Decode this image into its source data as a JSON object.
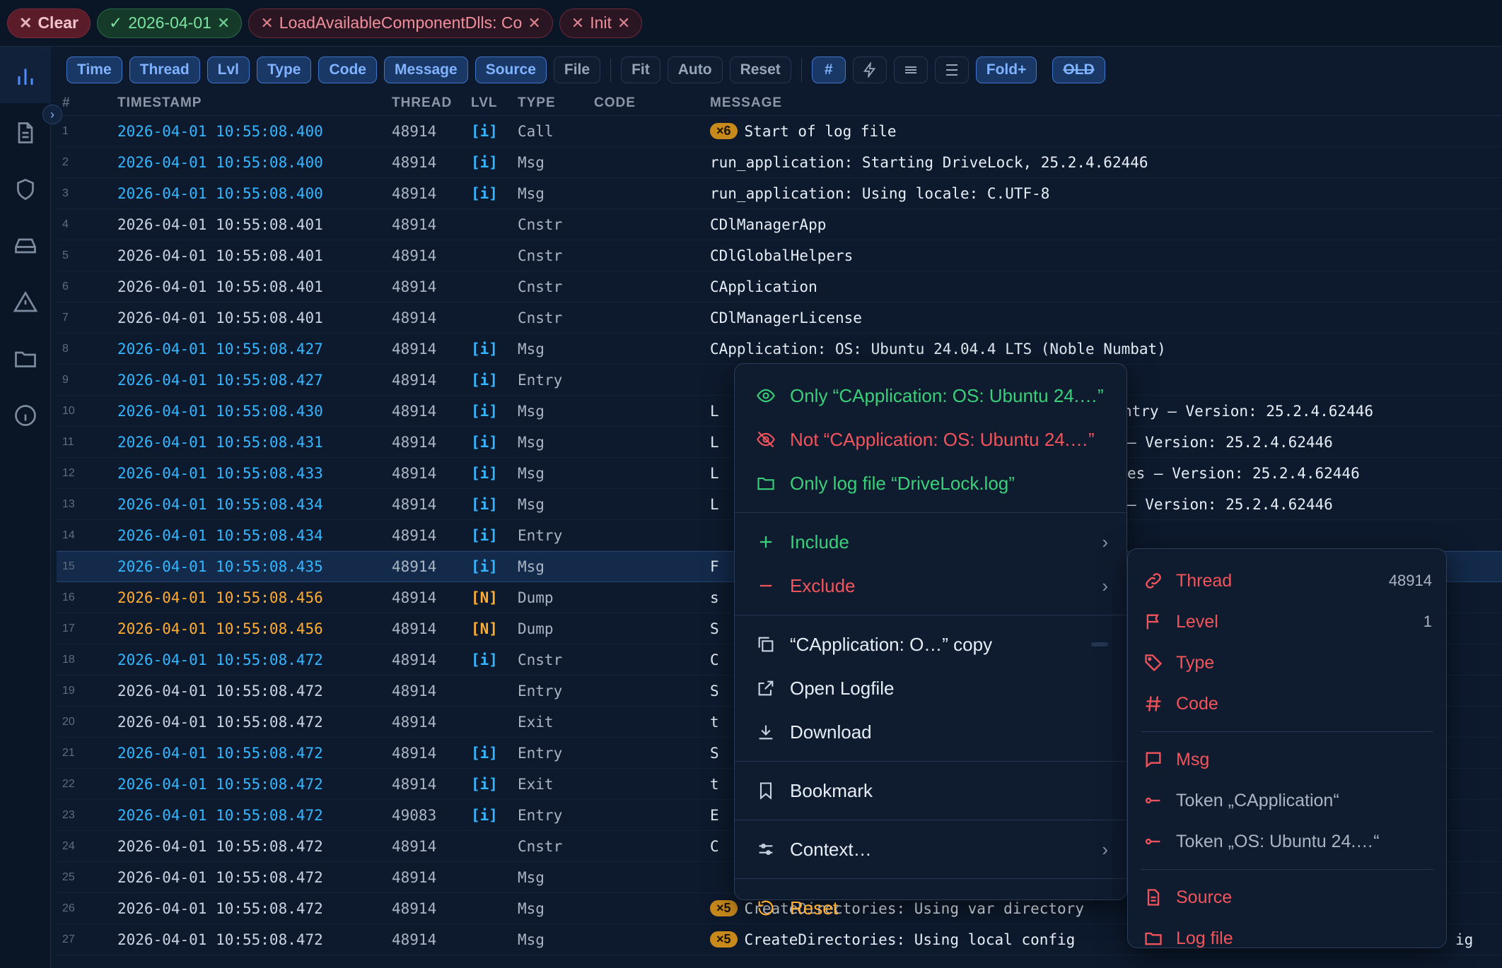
{
  "filters": {
    "clear": "Clear",
    "chips": [
      {
        "label": "2026-04-01",
        "kind": "include"
      },
      {
        "label": "LoadAvailableComponentDlls: Co",
        "kind": "exclude"
      },
      {
        "label": "Init",
        "kind": "exclude"
      }
    ]
  },
  "toolbar": {
    "columns": [
      "Time",
      "Thread",
      "Lvl",
      "Type",
      "Code",
      "Message",
      "Source",
      "File"
    ],
    "sizing": [
      "Fit",
      "Auto",
      "Reset"
    ],
    "hash": "#",
    "fold": "Fold+",
    "old": "OLD"
  },
  "table": {
    "headers": {
      "num": "#",
      "timestamp": "TIMESTAMP",
      "thread": "THREAD",
      "lvl": "LVL",
      "type": "TYPE",
      "code": "CODE",
      "message": "MESSAGE"
    },
    "rows": [
      {
        "n": "1",
        "ts": "2026-04-01 10:55:08.400",
        "th": "48914",
        "lvl": "[i]",
        "type": "Call",
        "badge": "×6",
        "msg": "Start of log file",
        "tone": "info"
      },
      {
        "n": "2",
        "ts": "2026-04-01 10:55:08.400",
        "th": "48914",
        "lvl": "[i]",
        "type": "Msg",
        "badge": "",
        "msg": "run_application: Starting DriveLock, 25.2.4.62446",
        "tone": "info"
      },
      {
        "n": "3",
        "ts": "2026-04-01 10:55:08.400",
        "th": "48914",
        "lvl": "[i]",
        "type": "Msg",
        "badge": "",
        "msg": "run_application: Using locale: C.UTF-8",
        "tone": "info"
      },
      {
        "n": "4",
        "ts": "2026-04-01 10:55:08.401",
        "th": "48914",
        "lvl": "",
        "type": "Cnstr",
        "badge": "",
        "msg": "CDlManagerApp",
        "tone": "plain"
      },
      {
        "n": "5",
        "ts": "2026-04-01 10:55:08.401",
        "th": "48914",
        "lvl": "",
        "type": "Cnstr",
        "badge": "",
        "msg": "CDlGlobalHelpers",
        "tone": "plain"
      },
      {
        "n": "6",
        "ts": "2026-04-01 10:55:08.401",
        "th": "48914",
        "lvl": "",
        "type": "Cnstr",
        "badge": "",
        "msg": "CApplication",
        "tone": "plain"
      },
      {
        "n": "7",
        "ts": "2026-04-01 10:55:08.401",
        "th": "48914",
        "lvl": "",
        "type": "Cnstr",
        "badge": "",
        "msg": "CDlManagerLicense",
        "tone": "plain"
      },
      {
        "n": "8",
        "ts": "2026-04-01 10:55:08.427",
        "th": "48914",
        "lvl": "[i]",
        "type": "Msg",
        "badge": "",
        "msg": "CApplication: OS: Ubuntu 24.04.4 LTS (Noble Numbat)",
        "tone": "info"
      },
      {
        "n": "9",
        "ts": "2026-04-01 10:55:08.427",
        "th": "48914",
        "lvl": "[i]",
        "type": "Entry",
        "badge": "",
        "msg": "",
        "tone": "info"
      },
      {
        "n": "10",
        "ts": "2026-04-01 10:55:08.430",
        "th": "48914",
        "lvl": "[i]",
        "type": "Msg",
        "badge": "",
        "msg": "L",
        "tone": "info"
      },
      {
        "n": "11",
        "ts": "2026-04-01 10:55:08.431",
        "th": "48914",
        "lvl": "[i]",
        "type": "Msg",
        "badge": "",
        "msg": "L",
        "tone": "info"
      },
      {
        "n": "12",
        "ts": "2026-04-01 10:55:08.433",
        "th": "48914",
        "lvl": "[i]",
        "type": "Msg",
        "badge": "",
        "msg": "L",
        "tone": "info"
      },
      {
        "n": "13",
        "ts": "2026-04-01 10:55:08.434",
        "th": "48914",
        "lvl": "[i]",
        "type": "Msg",
        "badge": "",
        "msg": "L",
        "tone": "info"
      },
      {
        "n": "14",
        "ts": "2026-04-01 10:55:08.434",
        "th": "48914",
        "lvl": "[i]",
        "type": "Entry",
        "badge": "",
        "msg": "",
        "tone": "info"
      },
      {
        "n": "15",
        "ts": "2026-04-01 10:55:08.435",
        "th": "48914",
        "lvl": "[i]",
        "type": "Msg",
        "badge": "",
        "msg": "F",
        "tone": "info",
        "selected": true
      },
      {
        "n": "16",
        "ts": "2026-04-01 10:55:08.456",
        "th": "48914",
        "lvl": "[N]",
        "type": "Dump",
        "badge": "",
        "msg": "s",
        "tone": "note"
      },
      {
        "n": "17",
        "ts": "2026-04-01 10:55:08.456",
        "th": "48914",
        "lvl": "[N]",
        "type": "Dump",
        "badge": "",
        "msg": "S",
        "tone": "note"
      },
      {
        "n": "18",
        "ts": "2026-04-01 10:55:08.472",
        "th": "48914",
        "lvl": "[i]",
        "type": "Cnstr",
        "badge": "",
        "msg": "C",
        "tone": "info"
      },
      {
        "n": "19",
        "ts": "2026-04-01 10:55:08.472",
        "th": "48914",
        "lvl": "",
        "type": "Entry",
        "badge": "",
        "msg": "S",
        "tone": "plain"
      },
      {
        "n": "20",
        "ts": "2026-04-01 10:55:08.472",
        "th": "48914",
        "lvl": "",
        "type": "Exit",
        "badge": "",
        "msg": "t",
        "tone": "plain"
      },
      {
        "n": "21",
        "ts": "2026-04-01 10:55:08.472",
        "th": "48914",
        "lvl": "[i]",
        "type": "Entry",
        "badge": "",
        "msg": "S",
        "tone": "info"
      },
      {
        "n": "22",
        "ts": "2026-04-01 10:55:08.472",
        "th": "48914",
        "lvl": "[i]",
        "type": "Exit",
        "badge": "",
        "msg": "t",
        "tone": "info"
      },
      {
        "n": "23",
        "ts": "2026-04-01 10:55:08.472",
        "th": "49083",
        "lvl": "[i]",
        "type": "Entry",
        "badge": "",
        "msg": "E",
        "tone": "info"
      },
      {
        "n": "24",
        "ts": "2026-04-01 10:55:08.472",
        "th": "48914",
        "lvl": "",
        "type": "Cnstr",
        "badge": "",
        "msg": "C",
        "tone": "plain"
      },
      {
        "n": "25",
        "ts": "2026-04-01 10:55:08.472",
        "th": "48914",
        "lvl": "",
        "type": "Msg",
        "badge": "",
        "msg": "",
        "tone": "plain"
      },
      {
        "n": "26",
        "ts": "2026-04-01 10:55:08.472",
        "th": "48914",
        "lvl": "",
        "type": "Msg",
        "badge": "×5",
        "msg": "CreateDirectories: Using var directory",
        "tone": "plain"
      },
      {
        "n": "27",
        "ts": "2026-04-01 10:55:08.472",
        "th": "48914",
        "lvl": "",
        "type": "Msg",
        "badge": "×5",
        "msg": "CreateDirectories: Using local config",
        "tone": "plain"
      }
    ],
    "overflow": {
      "r10": "ntry – Version: 25.2.4.62446",
      "r11": "– Version: 25.2.4.62446",
      "r12": "es – Version: 25.2.4.62446",
      "r13": "– Version: 25.2.4.62446",
      "r27": "ig"
    }
  },
  "context_menu": {
    "only": "Only “CApplication: OS: Ubuntu 24.…”",
    "not": "Not “CApplication: OS: Ubuntu 24.…”",
    "only_file": "Only log file “DriveLock.log”",
    "include": "Include",
    "exclude": "Exclude",
    "copy": "“CApplication: O…” copy",
    "open_logfile": "Open Logfile",
    "download": "Download",
    "bookmark": "Bookmark",
    "context": "Context…",
    "reset": "Reset"
  },
  "submenu": {
    "thread": "Thread",
    "thread_val": "48914",
    "level": "Level",
    "level_val": "1",
    "type": "Type",
    "code": "Code",
    "msg": "Msg",
    "token1": "Token „CApplication“",
    "token2": "Token „OS: Ubuntu 24.…“",
    "source": "Source",
    "logfile": "Log file"
  },
  "colors": {
    "info": "#35b6ff",
    "note": "#ffad33",
    "include": "#3ad07a",
    "exclude": "#f2545b"
  }
}
